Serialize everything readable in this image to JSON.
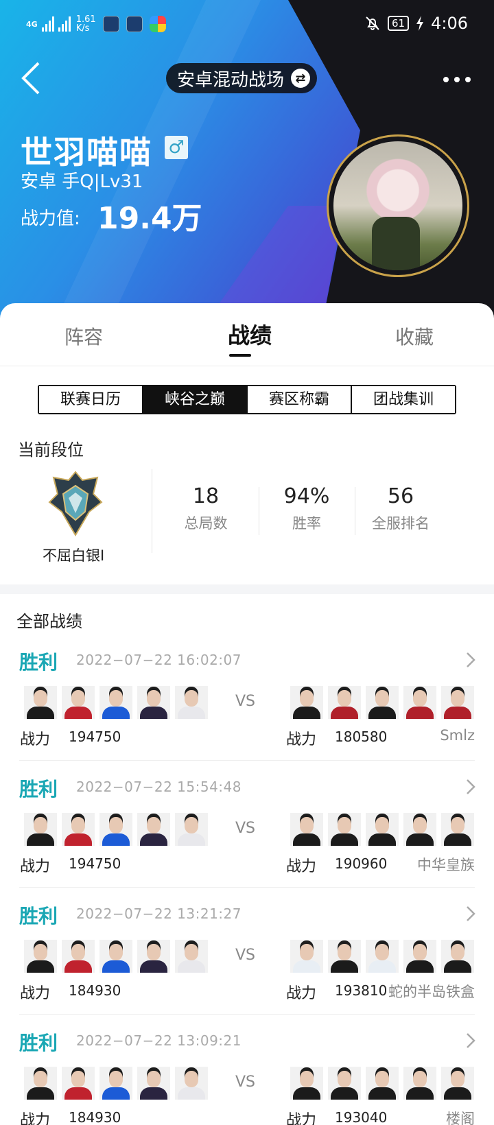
{
  "status_bar": {
    "network": "4G",
    "speed_value": "1.61",
    "speed_unit": "K/s",
    "battery": "61",
    "time": "4:06"
  },
  "header": {
    "mode_label": "安卓混动战场",
    "player_name": "世羽喵喵",
    "gender_symbol": "♂",
    "platform": "安卓  手Q|Lv31",
    "power_label": "战力值:",
    "power_value": "19.4万"
  },
  "tabs": [
    "阵容",
    "战绩",
    "收藏"
  ],
  "active_tab": "战绩",
  "segments": [
    "联赛日历",
    "峡谷之巅",
    "赛区称霸",
    "团战集训"
  ],
  "active_segment": "峡谷之巅",
  "rank": {
    "title": "当前段位",
    "rank_name": "不屈白银I",
    "stats": [
      {
        "value": "18",
        "label": "总局数"
      },
      {
        "value": "94%",
        "label": "胜率"
      },
      {
        "value": "56",
        "label": "全服排名"
      }
    ]
  },
  "records_title": "全部战绩",
  "records": [
    {
      "result": "胜利",
      "datetime": "2022−07−22  16:02:07",
      "power_label": "战力",
      "my_power": "194750",
      "vs": "VS",
      "opp_power_label": "战力",
      "opp_power": "180580",
      "opp_team": "Smlz"
    },
    {
      "result": "胜利",
      "datetime": "2022−07−22  15:54:48",
      "power_label": "战力",
      "my_power": "194750",
      "vs": "VS",
      "opp_power_label": "战力",
      "opp_power": "190960",
      "opp_team": "中华皇族"
    },
    {
      "result": "胜利",
      "datetime": "2022−07−22  13:21:27",
      "power_label": "战力",
      "my_power": "184930",
      "vs": "VS",
      "opp_power_label": "战力",
      "opp_power": "193810",
      "opp_team": "蛇的半岛铁盒"
    },
    {
      "result": "胜利",
      "datetime": "2022−07−22  13:09:21",
      "power_label": "战力",
      "my_power": "184930",
      "vs": "VS",
      "opp_power_label": "战力",
      "opp_power": "193040",
      "opp_team": "楼阁"
    }
  ],
  "colors": {
    "win": "#1aa7b4",
    "header_blue": "#2a8fe6",
    "header_dark": "#15151a",
    "avatar_ring": "#c9a24a"
  },
  "icons": [
    "back-arrow-icon",
    "swap-icon",
    "more-icon",
    "gender-male-icon",
    "rank-badge-icon",
    "chevron-right-icon"
  ]
}
